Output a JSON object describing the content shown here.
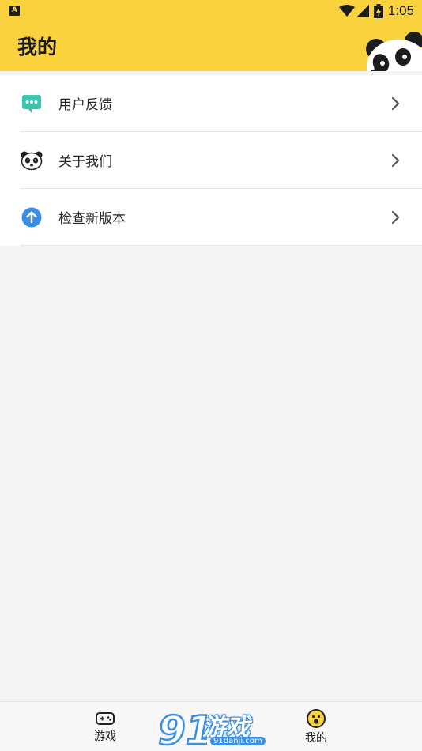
{
  "status_bar": {
    "app_badge": "A",
    "time": "1:05"
  },
  "header": {
    "title": "我的"
  },
  "menu": {
    "items": [
      {
        "label": "用户反馈",
        "icon": "feedback-chat-icon",
        "icon_color": "#3cc4ae"
      },
      {
        "label": "关于我们",
        "icon": "panda-icon",
        "icon_color": "#222222"
      },
      {
        "label": "检查新版本",
        "icon": "upgrade-arrow-icon",
        "icon_color": "#3a8ee6"
      }
    ]
  },
  "tabbar": {
    "tabs": [
      {
        "label": "游戏",
        "icon": "gamepad-icon"
      },
      {
        "label": "我的",
        "icon": "smiley-icon"
      }
    ]
  },
  "watermark": {
    "logo_text": "游戏",
    "url": "91danji.com"
  },
  "colors": {
    "header_bg": "#f9d23d",
    "page_bg": "#f4f4f4",
    "accent_blue": "#3a8ee6",
    "accent_green": "#3cc4ae"
  }
}
